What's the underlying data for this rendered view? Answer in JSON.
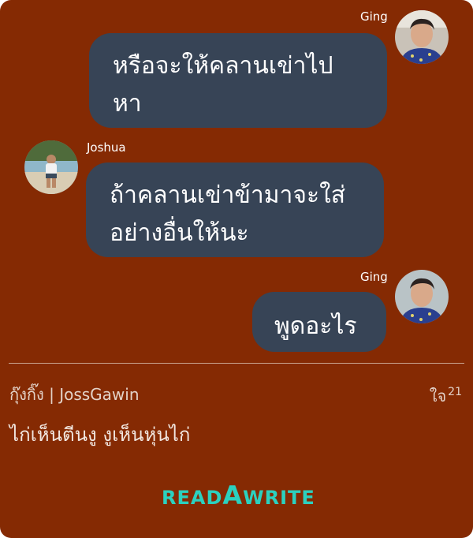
{
  "messages": [
    {
      "sender": "Ging",
      "side": "right",
      "lines": [
        "หรือจะให้คลานเข่าไป",
        "หา"
      ]
    },
    {
      "sender": "Joshua",
      "side": "left",
      "lines": [
        "ถ้าคลานเข่าข้ามาจะใส่",
        "อย่างอื่นให้นะ"
      ]
    },
    {
      "sender": "Ging",
      "side": "right",
      "lines": [
        "พูดอะไร"
      ]
    }
  ],
  "footer": {
    "author": "กุ๊งกิ๊ง | JossGawin",
    "likes_label": "ใจ",
    "likes_count": "21",
    "comment": "ไก่เห็นตีนงู งูเห็นหุ่นไก่"
  },
  "brand": {
    "logo_text": "READAWRITE",
    "logo_part1": "READ",
    "logo_part2": "A",
    "logo_part3": "WRITE",
    "logo_color": "#2bd1bf"
  },
  "colors": {
    "background": "#852a03",
    "bubble": "#374456",
    "text": "#ffffff"
  },
  "icons": {
    "ging_avatar": "avatar-photo-ging",
    "joshua_avatar": "avatar-photo-joshua"
  }
}
